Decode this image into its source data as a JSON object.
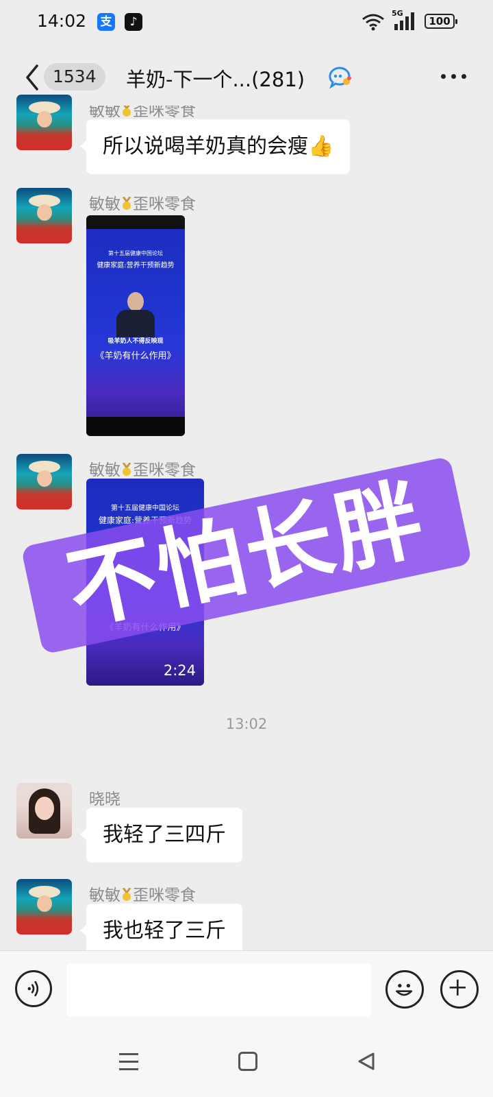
{
  "status_bar": {
    "time": "14:02",
    "alipay_icon_label": "支",
    "tiktok_icon_label": "♪",
    "network": "5G",
    "battery": "100"
  },
  "header": {
    "unread_count": "1534",
    "title": "羊奶-下一个...(281)"
  },
  "messages": [
    {
      "sender": "敏敏",
      "sender_suffix": "歪咪零食",
      "text": "所以说喝羊奶真的会瘦👍"
    },
    {
      "sender": "敏敏",
      "sender_suffix": "歪咪零食",
      "video": {
        "heading_line1": "第十五届健康中国论坛",
        "heading_line2": "健康家庭:营养干预新趋势",
        "caption_line1": "吸羊奶人不得反映现",
        "caption_line2": "《羊奶有什么作用》"
      }
    },
    {
      "sender": "敏敏",
      "sender_suffix": "歪咪零食",
      "video": {
        "heading_line1": "第十五届健康中国论坛",
        "heading_line2": "健康家庭:营养干预新趋势",
        "caption_line2": "《羊奶有什么作用》",
        "duration": "2:24"
      }
    },
    {
      "sender": "晓晓",
      "text": "我轻了三四斤"
    },
    {
      "sender": "敏敏",
      "sender_suffix": "歪咪零食",
      "text": "我也轻了三斤"
    }
  ],
  "timestamp": "13:02",
  "watermark": "不怕长胖",
  "input": {
    "placeholder": "",
    "value": ""
  },
  "colors": {
    "watermark": "#894cee",
    "bubble": "#ffffff",
    "background": "#ededed",
    "video": "#2034cf"
  },
  "icons": [
    "back-icon",
    "group-chat-icon",
    "more-icon",
    "medal-icon",
    "voice-icon",
    "emoji-icon",
    "plus-icon",
    "nav-menu-icon",
    "nav-home-icon",
    "nav-back-icon"
  ]
}
